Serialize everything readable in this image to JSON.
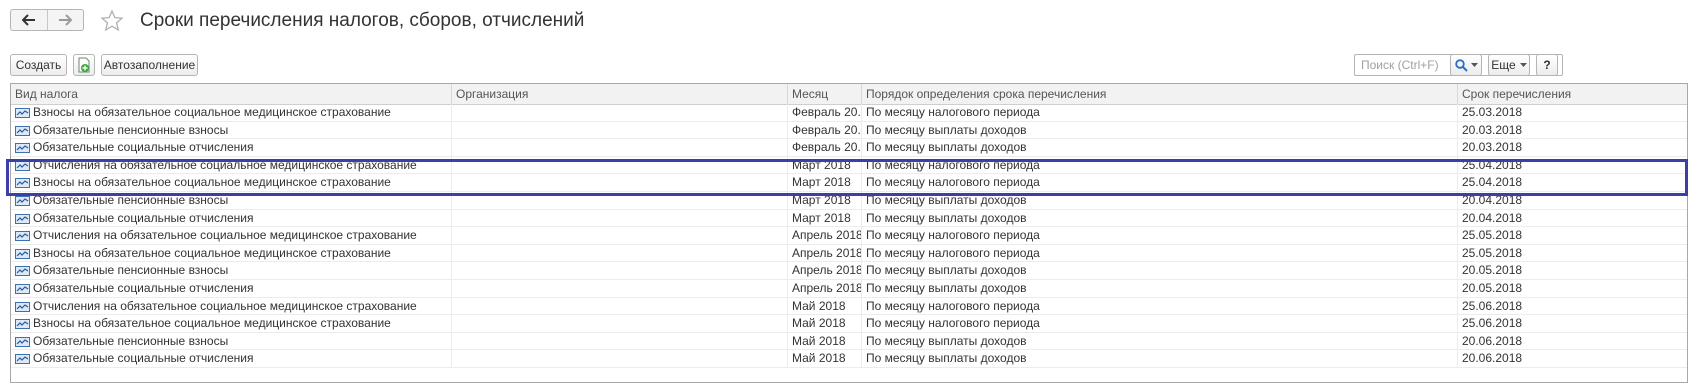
{
  "window": {
    "title": "Сроки перечисления налогов, сборов, отчислений",
    "back_icon": "arrow-left-icon",
    "forward_icon": "arrow-right-icon",
    "favorite_icon": "star-icon"
  },
  "toolbar": {
    "create_label": "Создать",
    "copy_icon": "add-copy-icon",
    "autofill_label": "Автозаполнение",
    "search_placeholder": "Поиск (Ctrl+F)",
    "search_clear": "×",
    "more_label": "Еще",
    "help_label": "?"
  },
  "table": {
    "columns": [
      "Вид налога",
      "Организация",
      "Месяц",
      "Порядок определения срока перечисления",
      "Срок перечисления"
    ],
    "row_icon": "catalog-item-icon",
    "rows": [
      [
        "Взносы на обязательное социальное медицинское страхование",
        "",
        "Февраль 20...",
        "По месяцу налогового периода",
        "25.03.2018"
      ],
      [
        "Обязательные пенсионные взносы",
        "",
        "Февраль 20...",
        "По месяцу выплаты доходов",
        "20.03.2018"
      ],
      [
        "Обязательные социальные отчисления",
        "",
        "Февраль 20...",
        "По месяцу выплаты доходов",
        "20.03.2018"
      ],
      [
        "Отчисления на обязательное социальное медицинское страхование",
        "",
        "Март 2018",
        "По месяцу налогового периода",
        "25.04.2018"
      ],
      [
        "Взносы на обязательное социальное медицинское страхование",
        "",
        "Март 2018",
        "По месяцу налогового периода",
        "25.04.2018"
      ],
      [
        "Обязательные пенсионные взносы",
        "",
        "Март 2018",
        "По месяцу выплаты доходов",
        "20.04.2018"
      ],
      [
        "Обязательные социальные отчисления",
        "",
        "Март 2018",
        "По месяцу выплаты доходов",
        "20.04.2018"
      ],
      [
        "Отчисления на обязательное социальное медицинское страхование",
        "",
        "Апрель 2018",
        "По месяцу налогового периода",
        "25.05.2018"
      ],
      [
        "Взносы на обязательное социальное медицинское страхование",
        "",
        "Апрель 2018",
        "По месяцу налогового периода",
        "25.05.2018"
      ],
      [
        "Обязательные пенсионные взносы",
        "",
        "Апрель 2018",
        "По месяцу выплаты доходов",
        "20.05.2018"
      ],
      [
        "Обязательные социальные отчисления",
        "",
        "Апрель 2018",
        "По месяцу выплаты доходов",
        "20.05.2018"
      ],
      [
        "Отчисления на обязательное социальное медицинское страхование",
        "",
        "Май 2018",
        "По месяцу налогового периода",
        "25.06.2018"
      ],
      [
        "Взносы на обязательное социальное медицинское страхование",
        "",
        "Май 2018",
        "По месяцу налогового периода",
        "25.06.2018"
      ],
      [
        "Обязательные пенсионные взносы",
        "",
        "Май 2018",
        "По месяцу выплаты доходов",
        "20.06.2018"
      ],
      [
        "Обязательные социальные отчисления",
        "",
        "Май 2018",
        "По месяцу выплаты доходов",
        "20.06.2018"
      ]
    ]
  },
  "highlight_color": "#3b3fa8"
}
